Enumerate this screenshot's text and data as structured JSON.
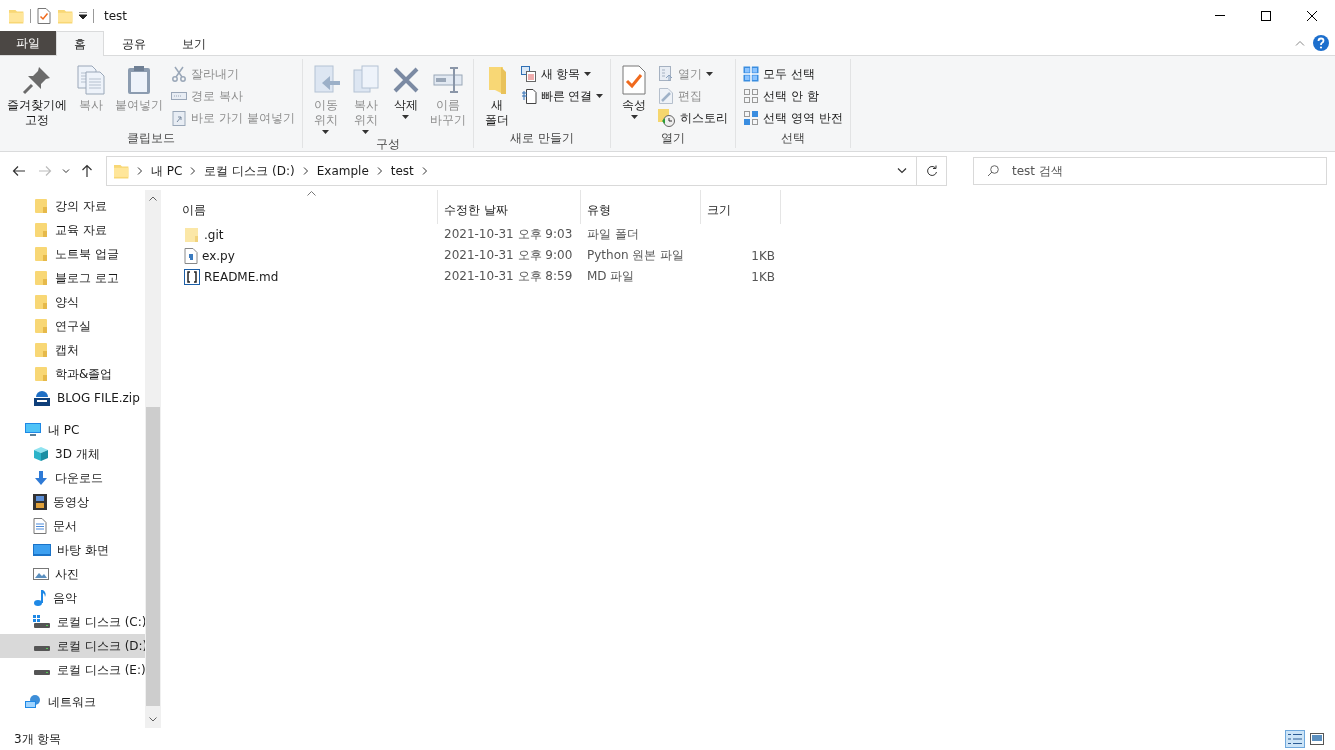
{
  "window": {
    "title": "test"
  },
  "tabs": [
    {
      "label": "파일",
      "kind": "menu",
      "selected": false
    },
    {
      "label": "홈",
      "kind": "tab",
      "selected": true
    },
    {
      "label": "공유",
      "kind": "tab",
      "selected": false
    },
    {
      "label": "보기",
      "kind": "tab",
      "selected": false
    }
  ],
  "ribbon": {
    "groups": [
      {
        "label": "클립보드",
        "items": [
          {
            "kind": "large",
            "label": "즐겨찾기에\n고정",
            "disabled": false,
            "dropdown": false
          },
          {
            "kind": "large",
            "label": "복사",
            "disabled": true,
            "dropdown": false
          },
          {
            "kind": "large",
            "label": "붙여넣기",
            "disabled": true,
            "dropdown": false
          },
          {
            "kind": "small",
            "label": "잘라내기",
            "disabled": true,
            "dropdown": false
          },
          {
            "kind": "small",
            "label": "경로 복사",
            "disabled": true,
            "dropdown": false
          },
          {
            "kind": "small",
            "label": "바로 가기 붙여넣기",
            "disabled": true,
            "dropdown": false
          }
        ]
      },
      {
        "label": "구성",
        "items": [
          {
            "kind": "large",
            "label": "이동\n위치",
            "disabled": true,
            "dropdown": true
          },
          {
            "kind": "large",
            "label": "복사\n위치",
            "disabled": true,
            "dropdown": true
          },
          {
            "kind": "large",
            "label": "삭제",
            "disabled": false,
            "dropdown": true
          },
          {
            "kind": "large",
            "label": "이름\n바꾸기",
            "disabled": true,
            "dropdown": false
          }
        ]
      },
      {
        "label": "새로 만들기",
        "items": [
          {
            "kind": "large",
            "label": "새\n폴더",
            "disabled": false,
            "dropdown": false
          },
          {
            "kind": "small",
            "label": "새 항목",
            "disabled": false,
            "dropdown": true
          },
          {
            "kind": "small",
            "label": "빠른 연결",
            "disabled": false,
            "dropdown": true
          }
        ]
      },
      {
        "label": "열기",
        "items": [
          {
            "kind": "large",
            "label": "속성",
            "disabled": false,
            "dropdown": true
          },
          {
            "kind": "small",
            "label": "열기",
            "disabled": true,
            "dropdown": true
          },
          {
            "kind": "small",
            "label": "편집",
            "disabled": true,
            "dropdown": false
          },
          {
            "kind": "small",
            "label": "히스토리",
            "disabled": false,
            "dropdown": false
          }
        ]
      },
      {
        "label": "선택",
        "items": [
          {
            "kind": "small",
            "label": "모두 선택",
            "disabled": false,
            "dropdown": false
          },
          {
            "kind": "small",
            "label": "선택 안 함",
            "disabled": false,
            "dropdown": false
          },
          {
            "kind": "small",
            "label": "선택 영역 반전",
            "disabled": false,
            "dropdown": false
          }
        ]
      }
    ]
  },
  "address_bar": {
    "path": [
      "내 PC",
      "로컬 디스크 (D:)",
      "Example",
      "test"
    ]
  },
  "search": {
    "placeholder": "test 검색"
  },
  "sidebar": {
    "pinned_items": [
      {
        "label": "강의 자료",
        "kind": "folder",
        "selected": false
      },
      {
        "label": "교육 자료",
        "kind": "folder",
        "selected": false
      },
      {
        "label": "노트북 업글",
        "kind": "folder",
        "selected": false
      },
      {
        "label": "블로그 로고",
        "kind": "folder",
        "selected": false
      },
      {
        "label": "양식",
        "kind": "folder",
        "selected": false
      },
      {
        "label": "연구실",
        "kind": "folder",
        "selected": false
      },
      {
        "label": "캡처",
        "kind": "folder",
        "selected": false
      },
      {
        "label": "학과&졸업",
        "kind": "folder",
        "selected": false
      },
      {
        "label": "BLOG FILE.zip",
        "kind": "zip",
        "selected": false
      }
    ],
    "tree": [
      {
        "label": "내 PC",
        "kind": "pc",
        "selected": false,
        "children": [
          {
            "label": "3D 개체",
            "kind": "cube",
            "selected": false
          },
          {
            "label": "다운로드",
            "kind": "download",
            "selected": false
          },
          {
            "label": "동영상",
            "kind": "video",
            "selected": false
          },
          {
            "label": "문서",
            "kind": "document",
            "selected": false
          },
          {
            "label": "바탕 화면",
            "kind": "desktop",
            "selected": false
          },
          {
            "label": "사진",
            "kind": "picture",
            "selected": false
          },
          {
            "label": "음악",
            "kind": "music",
            "selected": false
          },
          {
            "label": "로컬 디스크 (C:)",
            "kind": "system_drive",
            "selected": false
          },
          {
            "label": "로컬 디스크 (D:)",
            "kind": "drive",
            "selected": true
          },
          {
            "label": "로컬 디스크 (E:)",
            "kind": "drive",
            "selected": false
          }
        ]
      },
      {
        "label": "네트워크",
        "kind": "network",
        "selected": false
      }
    ]
  },
  "file_list": {
    "columns": [
      {
        "label": "이름",
        "sorted": true
      },
      {
        "label": "수정한 날짜",
        "sorted": false
      },
      {
        "label": "유형",
        "sorted": false
      },
      {
        "label": "크기",
        "sorted": false
      }
    ],
    "rows": [
      {
        "kind": "folder",
        "name": ".git",
        "modified": "2021-10-31 오후 9:03",
        "type": "파일 폴더"
      },
      {
        "kind": "python",
        "name": "ex.py",
        "modified": "2021-10-31 오후 9:00",
        "type": "Python 원본 파일",
        "size": "1KB"
      },
      {
        "kind": "markdown",
        "name": "README.md",
        "modified": "2021-10-31 오후 8:59",
        "type": "MD 파일",
        "size": "1KB"
      }
    ]
  },
  "status_bar": {
    "text": "3개 항목",
    "views": [
      {
        "selected": true
      },
      {
        "selected": false
      }
    ]
  }
}
